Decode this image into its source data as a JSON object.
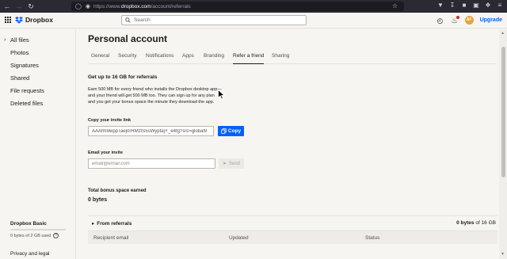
{
  "browser": {
    "url_prefix": "https://www.",
    "url_domain": "dropbox.com",
    "url_path": "/account/referrals"
  },
  "header": {
    "brand": "Dropbox",
    "search_placeholder": "Search",
    "avatar_initials": "AF",
    "upgrade_label": "Upgrade"
  },
  "sidebar": {
    "items": [
      {
        "label": "All files"
      },
      {
        "label": "Photos"
      },
      {
        "label": "Signatures"
      },
      {
        "label": "Shared"
      },
      {
        "label": "File requests"
      },
      {
        "label": "Deleted files"
      }
    ],
    "plan_name": "Dropbox Basic",
    "plan_used": "0 bytes of 2 GB used",
    "plan_fraction": 0.0,
    "privacy_label": "Privacy and legal"
  },
  "main": {
    "title": "Personal account",
    "tabs": [
      {
        "label": "General"
      },
      {
        "label": "Security"
      },
      {
        "label": "Notifications"
      },
      {
        "label": "Apps"
      },
      {
        "label": "Branding"
      },
      {
        "label": "Refer a friend"
      },
      {
        "label": "Sharing"
      }
    ],
    "active_tab": "Refer a friend",
    "referral_heading": "Get up to 16 GB for referrals",
    "referral_desc_lines": [
      "Earn 500 MB for every friend who installs the Dropbox desktop app—",
      "and your friend will get 500 MB too. They can sign up for any plan",
      "and you get your bonus space the minute they download the app."
    ],
    "copy_link_label": "Copy your invite link",
    "invite_link_value": "AAAfm9wppTaej0rRMztS5sWyptajY_e4fg?src=global9",
    "copy_button": "Copy",
    "email_label": "Email your invite",
    "email_placeholder": "email@email.com",
    "send_button": "Send",
    "bonus_label": "Total bonus space earned",
    "bonus_value": "0 bytes",
    "from_referrals_label": "From referrals",
    "referral_count_value": "0 bytes",
    "referral_count_suffix": "of 16 GB",
    "table_headers": [
      "Recipient email",
      "Updated",
      "Status"
    ]
  },
  "colors": {
    "accent": "#0061fe",
    "background": "#f7f5f2",
    "text": "#1e1919",
    "notification": "#c12e25"
  }
}
